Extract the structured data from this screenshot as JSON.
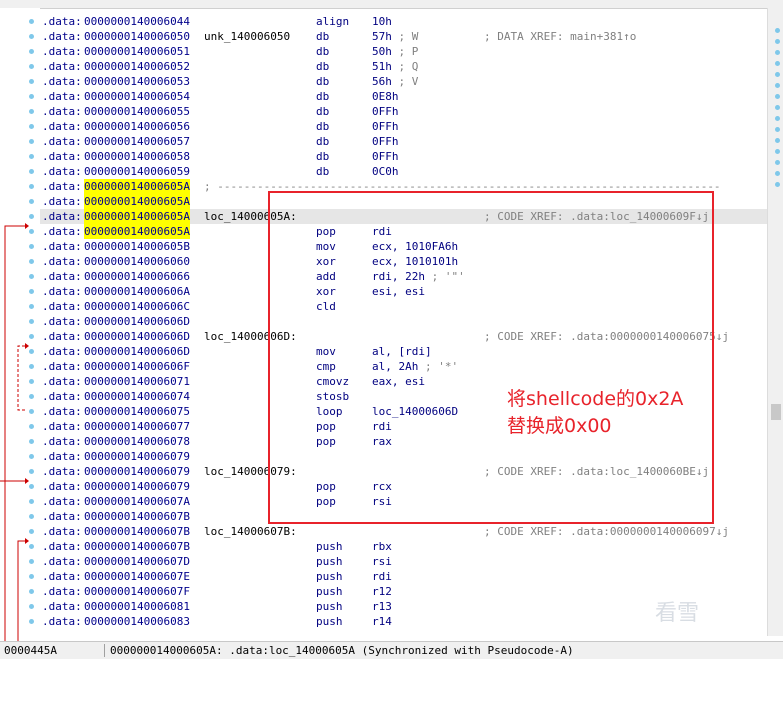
{
  "listing": {
    "rows": [
      {
        "seg": ".data:",
        "addr": "0000000140006044",
        "mnem": "align",
        "ops": "10h"
      },
      {
        "seg": ".data:",
        "addr": "0000000140006050",
        "label": "unk_140006050",
        "mnem": "db",
        "ops": "57h",
        "comment": "; W",
        "xref": "; DATA XREF: main+381↑o"
      },
      {
        "seg": ".data:",
        "addr": "0000000140006051",
        "mnem": "db",
        "ops": "50h",
        "comment": "; P"
      },
      {
        "seg": ".data:",
        "addr": "0000000140006052",
        "mnem": "db",
        "ops": "51h",
        "comment": "; Q"
      },
      {
        "seg": ".data:",
        "addr": "0000000140006053",
        "mnem": "db",
        "ops": "56h",
        "comment": "; V"
      },
      {
        "seg": ".data:",
        "addr": "0000000140006054",
        "mnem": "db",
        "ops": "0E8h"
      },
      {
        "seg": ".data:",
        "addr": "0000000140006055",
        "mnem": "db",
        "ops": "0FFh"
      },
      {
        "seg": ".data:",
        "addr": "0000000140006056",
        "mnem": "db",
        "ops": "0FFh"
      },
      {
        "seg": ".data:",
        "addr": "0000000140006057",
        "mnem": "db",
        "ops": "0FFh"
      },
      {
        "seg": ".data:",
        "addr": "0000000140006058",
        "mnem": "db",
        "ops": "0FFh"
      },
      {
        "seg": ".data:",
        "addr": "0000000140006059",
        "mnem": "db",
        "ops": "0C0h"
      },
      {
        "seg": ".data:",
        "addr": "000000014000605A",
        "yellow": true,
        "separator": "; ----------------------------------------------------------------------------"
      },
      {
        "seg": ".data:",
        "addr": "000000014000605A",
        "yellow": true
      },
      {
        "seg": ".data:",
        "addr": "000000014000605A",
        "yellow": true,
        "current": true,
        "label": "loc_14000605A:",
        "xref": "; CODE XREF: .data:loc_14000609F↓j"
      },
      {
        "seg": ".data:",
        "addr": "000000014000605A",
        "yellow": true,
        "mnem": "pop",
        "ops": "rdi"
      },
      {
        "seg": ".data:",
        "addr": "000000014000605B",
        "mnem": "mov",
        "ops": "ecx, 1010FA6h"
      },
      {
        "seg": ".data:",
        "addr": "0000000140006060",
        "mnem": "xor",
        "ops": "ecx, 1010101h"
      },
      {
        "seg": ".data:",
        "addr": "0000000140006066",
        "mnem": "add",
        "ops": "rdi, 22h",
        "comment": "; '\"'"
      },
      {
        "seg": ".data:",
        "addr": "000000014000606A",
        "mnem": "xor",
        "ops": "esi, esi"
      },
      {
        "seg": ".data:",
        "addr": "000000014000606C",
        "mnem": "cld"
      },
      {
        "seg": ".data:",
        "addr": "000000014000606D"
      },
      {
        "seg": ".data:",
        "addr": "000000014000606D",
        "label": "loc_14000606D:",
        "xref": "; CODE XREF: .data:0000000140006075↓j"
      },
      {
        "seg": ".data:",
        "addr": "000000014000606D",
        "mnem": "mov",
        "ops": "al, [rdi]"
      },
      {
        "seg": ".data:",
        "addr": "000000014000606F",
        "mnem": "cmp",
        "ops": "al, 2Ah",
        "comment": "; '*'"
      },
      {
        "seg": ".data:",
        "addr": "0000000140006071",
        "mnem": "cmovz",
        "ops": "eax, esi"
      },
      {
        "seg": ".data:",
        "addr": "0000000140006074",
        "mnem": "stosb"
      },
      {
        "seg": ".data:",
        "addr": "0000000140006075",
        "mnem": "loop",
        "ops": "loc_14000606D"
      },
      {
        "seg": ".data:",
        "addr": "0000000140006077",
        "mnem": "pop",
        "ops": "rdi"
      },
      {
        "seg": ".data:",
        "addr": "0000000140006078",
        "mnem": "pop",
        "ops": "rax"
      },
      {
        "seg": ".data:",
        "addr": "0000000140006079"
      },
      {
        "seg": ".data:",
        "addr": "0000000140006079",
        "label": "loc_140006079:",
        "xref": "; CODE XREF: .data:loc_1400060BE↓j"
      },
      {
        "seg": ".data:",
        "addr": "0000000140006079",
        "mnem": "pop",
        "ops": "rcx"
      },
      {
        "seg": ".data:",
        "addr": "000000014000607A",
        "mnem": "pop",
        "ops": "rsi"
      },
      {
        "seg": ".data:",
        "addr": "000000014000607B"
      },
      {
        "seg": ".data:",
        "addr": "000000014000607B",
        "label": "loc_14000607B:",
        "xref": "; CODE XREF: .data:0000000140006097↓j"
      },
      {
        "seg": ".data:",
        "addr": "000000014000607B",
        "mnem": "push",
        "ops": "rbx"
      },
      {
        "seg": ".data:",
        "addr": "000000014000607D",
        "mnem": "push",
        "ops": "rsi"
      },
      {
        "seg": ".data:",
        "addr": "000000014000607E",
        "mnem": "push",
        "ops": "rdi"
      },
      {
        "seg": ".data:",
        "addr": "000000014000607F",
        "mnem": "push",
        "ops": "r12"
      },
      {
        "seg": ".data:",
        "addr": "0000000140006081",
        "mnem": "push",
        "ops": "r13"
      },
      {
        "seg": ".data:",
        "addr": "0000000140006083",
        "mnem": "push",
        "ops": "r14"
      }
    ]
  },
  "annotation": {
    "text": "将shellcode的0x2A\n替换成0x00",
    "color": "#e8232b"
  },
  "status_bar": {
    "offset": "0000445A",
    "text": "000000014000605A: .data:loc_14000605A (Synchronized with Pseudocode-A)"
  },
  "watermark": "看雪",
  "colors": {
    "segment": "#00008b",
    "address_highlight": "#ffff00",
    "current_line": "#e6e6e6",
    "comment": "#808080",
    "arrow": "#cc0000",
    "dot": "#7fc8ea"
  }
}
